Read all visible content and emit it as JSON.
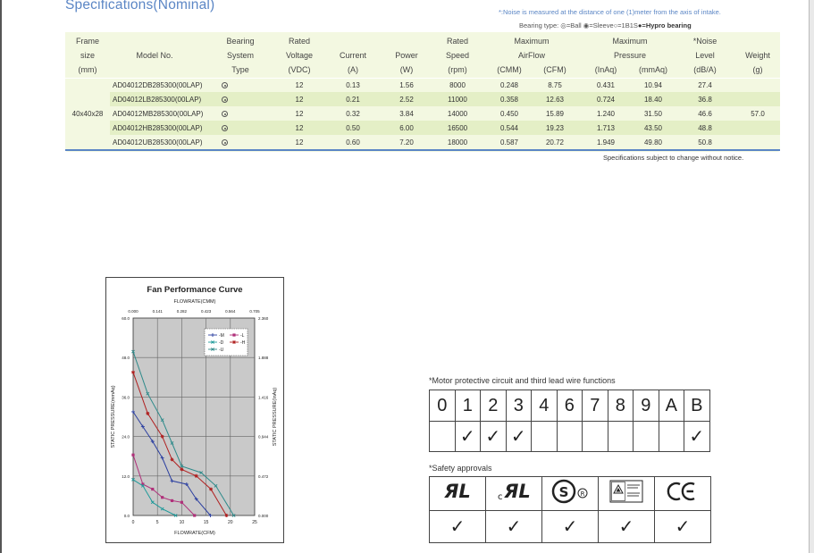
{
  "page": {
    "title": "Specifications(Nominal)",
    "noise_note": "*:Noise is measured at the distance of one (1)meter from the axis of intake.",
    "bearing_type_legend": "Bearing type: ◎=Ball ◉=Sleeve○=1B1S",
    "bearing_type_hypro": "●=Hypro bearing",
    "change_note": "Specifications subject to change without notice."
  },
  "spec_table": {
    "headers": {
      "frame_size": [
        "Frame",
        "size",
        "(mm)"
      ],
      "model_no": "Model No.",
      "bearing": [
        "Bearing",
        "System",
        "Type"
      ],
      "voltage": [
        "Rated",
        "Voltage",
        "(VDC)"
      ],
      "current": [
        "Current",
        "(A)"
      ],
      "power": [
        "Power",
        "(W)"
      ],
      "speed": [
        "Rated",
        "Speed",
        "(rpm)"
      ],
      "airflow": [
        "Maximum",
        "AirFlow",
        "(CMM)",
        "(CFM)"
      ],
      "pressure": [
        "Maximum",
        "Pressure",
        "(InAq)",
        "(mmAq)"
      ],
      "noise": [
        "*Noise",
        "Level",
        "(dB/A)"
      ],
      "weight": [
        "Weight",
        "(g)"
      ]
    },
    "frame_size": "40x40x28",
    "weight": "57.0",
    "rows": [
      {
        "model": "AD04012DB285300(00LAP)",
        "voltage": "12",
        "current": "0.13",
        "power": "1.56",
        "speed": "8000",
        "cmm": "0.248",
        "cfm": "8.75",
        "inaq": "0.431",
        "mmaq": "10.94",
        "noise": "27.4"
      },
      {
        "model": "AD04012LB285300(00LAP)",
        "voltage": "12",
        "current": "0.21",
        "power": "2.52",
        "speed": "11000",
        "cmm": "0.358",
        "cfm": "12.63",
        "inaq": "0.724",
        "mmaq": "18.40",
        "noise": "36.8"
      },
      {
        "model": "AD04012MB285300(00LAP)",
        "voltage": "12",
        "current": "0.32",
        "power": "3.84",
        "speed": "14000",
        "cmm": "0.450",
        "cfm": "15.89",
        "inaq": "1.240",
        "mmaq": "31.50",
        "noise": "46.6"
      },
      {
        "model": "AD04012HB285300(00LAP)",
        "voltage": "12",
        "current": "0.50",
        "power": "6.00",
        "speed": "16500",
        "cmm": "0.544",
        "cfm": "19.23",
        "inaq": "1.713",
        "mmaq": "43.50",
        "noise": "48.8"
      },
      {
        "model": "AD04012UB285300(00LAP)",
        "voltage": "12",
        "current": "0.60",
        "power": "7.20",
        "speed": "18000",
        "cmm": "0.587",
        "cfm": "20.72",
        "inaq": "1.949",
        "mmaq": "49.80",
        "noise": "50.8"
      }
    ]
  },
  "chart_data": {
    "type": "line",
    "title": "Fan Performance Curve",
    "top_axis_label": "FLOWRATE(CMM)",
    "top_ticks": [
      "0.000",
      "0.141",
      "0.282",
      "0.423",
      "0.564",
      "0.705"
    ],
    "xlabel": "FLOWRATE(CFM)",
    "x_ticks": [
      "0",
      "5",
      "10",
      "15",
      "20",
      "25"
    ],
    "xlim": [
      0,
      25
    ],
    "ylabel_left": "STATIC PRESSURE(mmAq)",
    "ylabel_right": "STATIC PRESSURE(InAq)",
    "y_ticks_left": [
      "0.0",
      "12.0",
      "24.0",
      "36.0",
      "48.0",
      "60.0"
    ],
    "y_ticks_right": [
      "0.000",
      "0.472",
      "0.944",
      "1.416",
      "1.888",
      "2.360"
    ],
    "ylim": [
      0,
      60
    ],
    "grid": true,
    "legend_position": "top-right",
    "series": [
      {
        "name": "M",
        "color": "#2b3fa0",
        "marker": "plus",
        "points": [
          [
            0,
            31.5
          ],
          [
            2,
            27
          ],
          [
            4,
            22.5
          ],
          [
            6,
            17.5
          ],
          [
            8,
            10.5
          ],
          [
            11,
            9.5
          ],
          [
            13,
            5
          ],
          [
            15.9,
            0
          ]
        ]
      },
      {
        "name": "L",
        "color": "#b0307a",
        "marker": "square",
        "points": [
          [
            0,
            18.4
          ],
          [
            2,
            9.5
          ],
          [
            4,
            8
          ],
          [
            6,
            5.5
          ],
          [
            8,
            4.5
          ],
          [
            10,
            4
          ],
          [
            12.63,
            0
          ]
        ]
      },
      {
        "name": "D",
        "color": "#1e9a9a",
        "marker": "cross",
        "points": [
          [
            0,
            10.9
          ],
          [
            2,
            9
          ],
          [
            4,
            4
          ],
          [
            6,
            2
          ],
          [
            8.75,
            0
          ]
        ]
      },
      {
        "name": "H",
        "color": "#b02020",
        "marker": "star",
        "points": [
          [
            0,
            43.5
          ],
          [
            3,
            31
          ],
          [
            6,
            24
          ],
          [
            8,
            17
          ],
          [
            10,
            14
          ],
          [
            13,
            12
          ],
          [
            16,
            8
          ],
          [
            19.2,
            0
          ]
        ]
      },
      {
        "name": "U",
        "color": "#2e8a8a",
        "marker": "cross",
        "points": [
          [
            0,
            49.8
          ],
          [
            3,
            37
          ],
          [
            6,
            29
          ],
          [
            8,
            22
          ],
          [
            10,
            15
          ],
          [
            14,
            13
          ],
          [
            17,
            9
          ],
          [
            20.7,
            0
          ]
        ]
      }
    ]
  },
  "motor": {
    "title": "*Motor protective circuit and third lead wire functions",
    "codes": [
      "0",
      "1",
      "2",
      "3",
      "4",
      "6",
      "7",
      "8",
      "9",
      "A",
      "B"
    ],
    "checked": [
      false,
      true,
      true,
      true,
      false,
      false,
      false,
      false,
      false,
      false,
      true
    ],
    "check_glyph": "✓"
  },
  "safety": {
    "title": "*Safety approvals",
    "approvals": [
      {
        "name": "UL",
        "logo": "ʀʟ",
        "checked": true
      },
      {
        "name": "cUL",
        "logo": "cʀʟ",
        "checked": true
      },
      {
        "name": "CSA",
        "logo": "SP",
        "checked": true
      },
      {
        "name": "TUV",
        "logo": "△",
        "checked": true
      },
      {
        "name": "CE",
        "logo": "CE",
        "checked": true
      }
    ],
    "check_glyph": "✓"
  }
}
